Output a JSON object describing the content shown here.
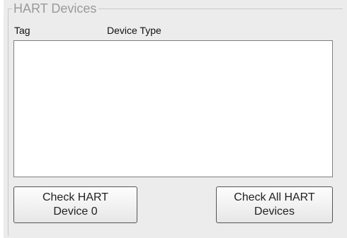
{
  "group": {
    "title": "HART Devices"
  },
  "list": {
    "columns": [
      "Tag",
      "Device Type"
    ],
    "rows": []
  },
  "buttons": {
    "check_device": "Check HART\nDevice 0",
    "check_all": "Check All HART\nDevices"
  }
}
